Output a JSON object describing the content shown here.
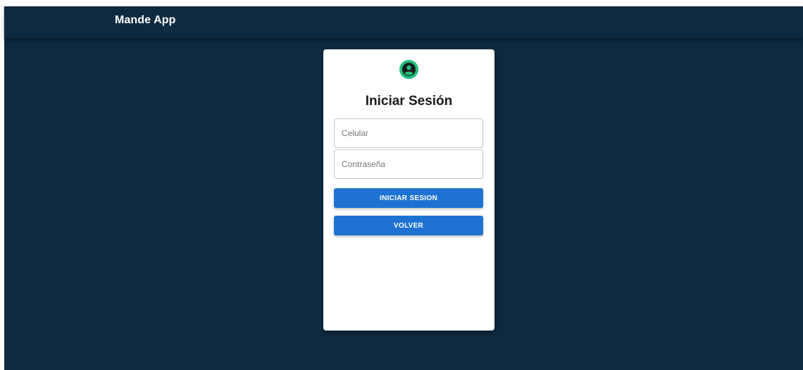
{
  "app_bar": {
    "title": "Mande App"
  },
  "login_card": {
    "icon": "account-circle-icon",
    "title": "Iniciar Sesión",
    "phone_field": {
      "placeholder": "Celular",
      "value": ""
    },
    "password_field": {
      "placeholder": "Contraseña",
      "value": ""
    },
    "login_button_label": "INICIAR SESION",
    "back_button_label": "VOLVER"
  },
  "colors": {
    "background": "#0e2a41",
    "card": "#ffffff",
    "accent_green": "#21c07a",
    "button_blue": "#1e73d2"
  }
}
